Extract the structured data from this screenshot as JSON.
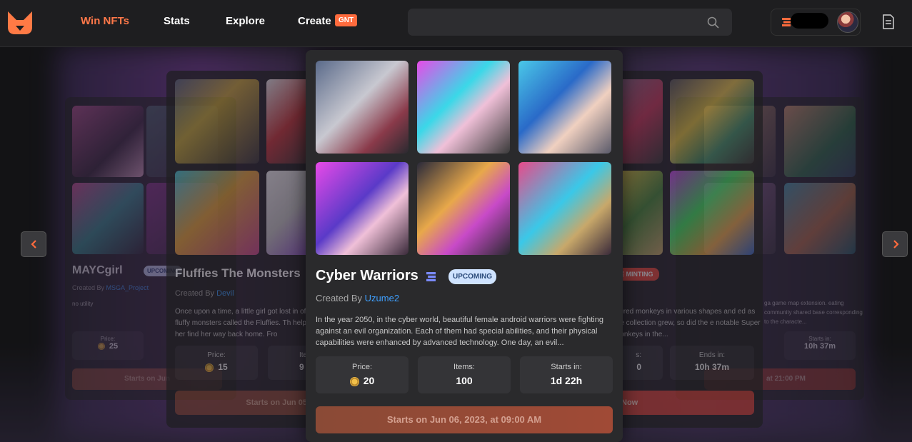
{
  "header": {
    "nav": [
      "Win NFTs",
      "Stats",
      "Explore",
      "Create"
    ],
    "create_badge": "GNT",
    "search": {
      "placeholder": "",
      "value": ""
    }
  },
  "cards": {
    "far_left": {
      "title": "MAYCgirl",
      "badge": "UPCOMING",
      "created_by": "Created By",
      "creator": "MSGA_Project",
      "description": "no utility",
      "price_label": "Price:",
      "price": "25",
      "button": "Starts on Jun"
    },
    "left": {
      "title": "Fluffies The Monsters",
      "created_by": "Created By",
      "creator": "Devil",
      "description": "Once upon a time, a little girl got lost in of fluffy monsters called the Fluffies. Th helped her find her way back home. Fro",
      "price_label": "Price:",
      "price": "15",
      "items_label": "Ite",
      "items": "9",
      "button": "Starts on Jun 05,"
    },
    "center": {
      "title": "Cyber Warriors",
      "badge": "UPCOMING",
      "created_by": "Created By",
      "creator": "Uzume2",
      "description": "In the year 2050, in the cyber world, beautiful female android warriors were fighting against an evil organization. Each of them had special abilities, and their physical capabilities were enhanced by advanced technology. One day, an evil...",
      "price_label": "Price:",
      "price": "20",
      "items_label": "Items:",
      "items": "100",
      "starts_label": "Starts in:",
      "starts": "1d 22h",
      "button": "Starts on Jun 06, 2023, at 09:00 AM"
    },
    "right": {
      "badge": "E MINTING",
      "description": "wered monkeys in various shapes and ed as the collection grew, so did the e notable Super Monkeys in the...",
      "stat1_label": "s:",
      "stat1": "0",
      "ends_label": "Ends in:",
      "ends": "10h 37m",
      "button": "Now"
    },
    "far_right": {
      "description": "ga game map extension. eating community shared base corresponding to the characte...",
      "starts_label": "Starts in:",
      "starts": "10h 37m",
      "button": "at 21:00 PM"
    }
  },
  "colors": {
    "accent": "#ff7849",
    "link": "#3fa0ff",
    "badge_bg": "#cfe3ff",
    "minting": "#e5483a"
  }
}
